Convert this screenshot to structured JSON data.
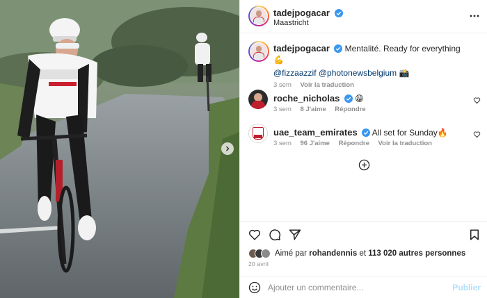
{
  "post": {
    "author": "tadejpogacar",
    "location": "Maastricht",
    "caption": "Mentalité. Ready for everything 💪",
    "caption_mentions": [
      "@fizzaazzif",
      "@photonewsbelgium"
    ],
    "caption_mentions_suffix": "📸",
    "caption_time": "3 sem",
    "caption_translate": "Voir la traduction"
  },
  "comments": [
    {
      "author": "roche_nicholas",
      "text": "😁",
      "time": "3 sem",
      "likes": "8 J'aime",
      "reply": "Répondre"
    },
    {
      "author": "uae_team_emirates",
      "text": "All set for Sunday🔥",
      "time": "3 sem",
      "likes": "96 J'aime",
      "reply": "Répondre",
      "translate": "Voir la traduction"
    }
  ],
  "likes_summary": {
    "prefix": "Aimé par",
    "user": "rohandennis",
    "connector": "et",
    "count": "113 020 autres personnes"
  },
  "date": "20 avril",
  "comment_box": {
    "placeholder": "Ajouter un commentaire...",
    "publish_label": "Publier"
  },
  "colors": {
    "verified": "#3897f0",
    "mention": "#00376b",
    "muted": "#8e8e8e",
    "publish_disabled": "#b2dffc"
  },
  "icons": {
    "more": "more-horizontal-icon",
    "heart": "heart-icon",
    "comment": "comment-icon",
    "share": "share-icon",
    "save": "bookmark-icon",
    "emoji": "emoji-icon",
    "load_more": "plus-circle-icon",
    "carousel_next": "chevron-right-icon"
  }
}
